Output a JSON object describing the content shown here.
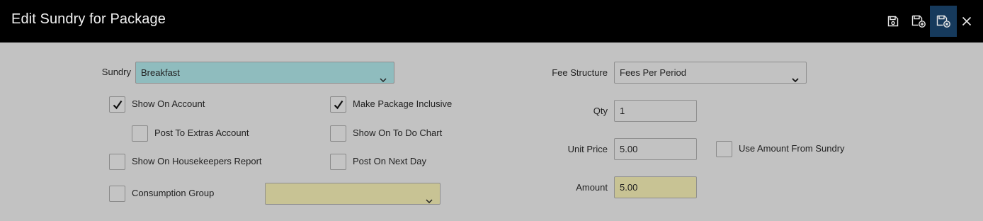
{
  "window": {
    "title": "Edit Sundry for Package"
  },
  "header_actions": [
    {
      "name": "save-icon",
      "tooltip": ""
    },
    {
      "name": "save-add-icon",
      "tooltip": ""
    },
    {
      "name": "save-close-icon",
      "tooltip": ""
    },
    {
      "name": "close-icon",
      "tooltip": ""
    }
  ],
  "form": {
    "sundry": {
      "label": "Sundry",
      "value": "Breakfast"
    },
    "show_on_account": {
      "label": "Show On Account",
      "checked": true
    },
    "post_to_extras_account": {
      "label": "Post To Extras Account",
      "checked": false
    },
    "show_on_housekeepers_report": {
      "label": "Show On Housekeepers Report",
      "checked": false
    },
    "consumption_group": {
      "label": "Consumption Group",
      "checked": false,
      "value": ""
    },
    "make_package_inclusive": {
      "label": "Make Package Inclusive",
      "checked": true
    },
    "show_on_to_do_chart": {
      "label": "Show On To Do Chart",
      "checked": false
    },
    "post_on_next_day": {
      "label": "Post On Next Day",
      "checked": false
    },
    "fee_structure": {
      "label": "Fee Structure",
      "value": "Fees Per Period"
    },
    "qty": {
      "label": "Qty",
      "value": "1"
    },
    "unit_price": {
      "label": "Unit Price",
      "value": "5.00"
    },
    "use_amount_from_sundry": {
      "label": "Use Amount From Sundry",
      "checked": false
    },
    "amount": {
      "label": "Amount",
      "value": "5.00"
    }
  },
  "colors": {
    "header_bg": "#000000",
    "body_bg": "#c2c2c2",
    "sundry_select_bg": "#8fbcbe",
    "highlight_field_bg": "#c8c394",
    "active_button_bg": "#163a5c"
  }
}
